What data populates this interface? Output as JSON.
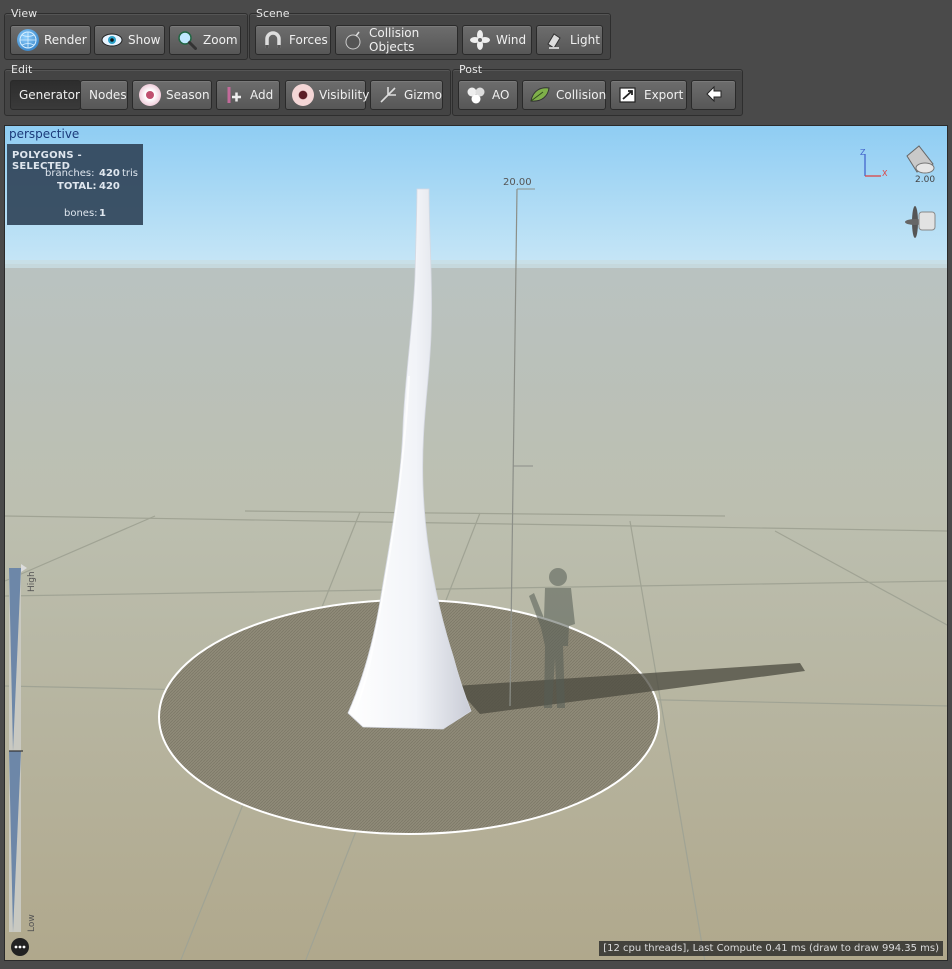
{
  "toolbar": {
    "view": {
      "label": "View",
      "buttons": [
        {
          "label": "Render",
          "icon": "globe-icon"
        },
        {
          "label": "Show",
          "icon": "eye-icon"
        },
        {
          "label": "Zoom",
          "icon": "magnifier-icon"
        }
      ]
    },
    "scene": {
      "label": "Scene",
      "buttons": [
        {
          "label": "Forces",
          "icon": "magnet-icon"
        },
        {
          "label": "Collision Objects",
          "icon": "bomb-icon"
        },
        {
          "label": "Wind",
          "icon": "fan-icon"
        },
        {
          "label": "Light",
          "icon": "spotlight-icon"
        }
      ]
    },
    "edit": {
      "label": "Edit",
      "generators": "Generators",
      "nodes": "Nodes",
      "buttons": [
        {
          "label": "Season",
          "icon": "season-icon"
        },
        {
          "label": "Add",
          "icon": "add-icon"
        },
        {
          "label": "Visibility",
          "icon": "eyeball-icon"
        },
        {
          "label": "Gizmo",
          "icon": "gizmo-icon"
        }
      ]
    },
    "post": {
      "label": "Post",
      "buttons": [
        {
          "label": "AO",
          "icon": "ao-icon"
        },
        {
          "label": "Collision",
          "icon": "leaf-icon"
        },
        {
          "label": "Export",
          "icon": "export-icon"
        },
        {
          "label": "",
          "icon": "back-arrow-icon"
        }
      ]
    }
  },
  "viewport": {
    "title": "perspective",
    "ruler_label": "20.00",
    "light_value": "2.00",
    "axis_z": "Z",
    "axis_x": "X",
    "polygons": {
      "header": "POLYGONS - SELECTED",
      "branches_label": "branches:",
      "branches_value": "420",
      "branches_unit": "tris",
      "total_label": "TOTAL:",
      "total_value": "420",
      "bones_label": "bones:",
      "bones_value": "1"
    },
    "lod": {
      "high": "High",
      "low": "Low"
    },
    "status": "[12 cpu threads], Last Compute 0.41 ms (draw to draw 994.35 ms)"
  }
}
